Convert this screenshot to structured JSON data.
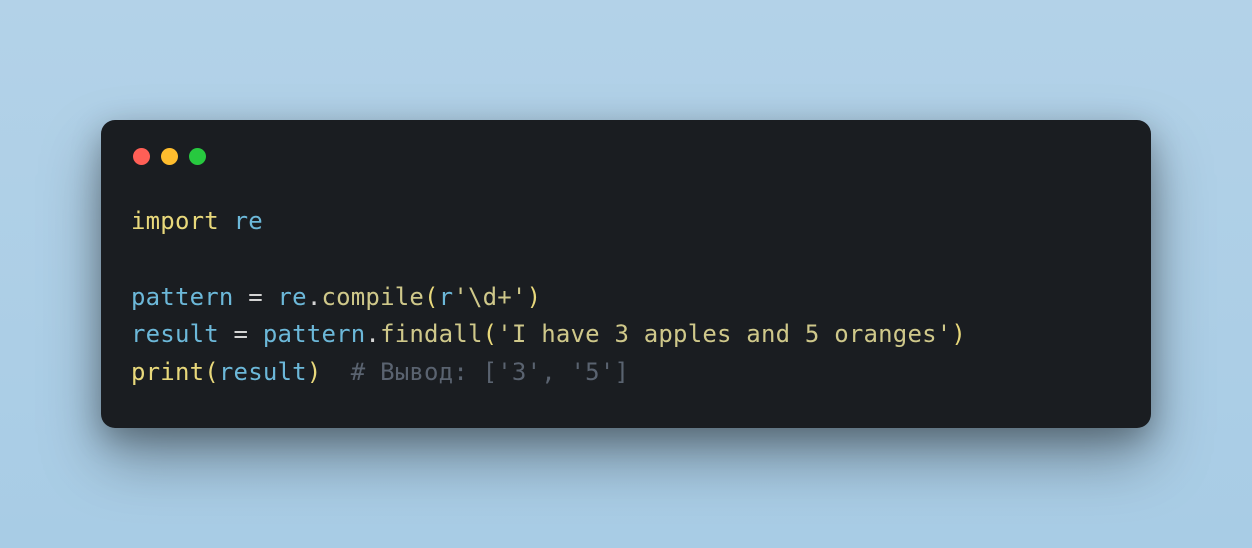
{
  "window": {
    "traffic_lights": [
      "red",
      "yellow",
      "green"
    ]
  },
  "code": {
    "line1": {
      "import_kw": "import",
      "module": "re"
    },
    "line2_blank": "",
    "line3": {
      "var": "pattern",
      "eq": " = ",
      "obj": "re",
      "dot": ".",
      "method": "compile",
      "open": "(",
      "prefix": "r",
      "str": "'\\d+'",
      "close": ")"
    },
    "line4": {
      "var": "result",
      "eq": " = ",
      "obj": "pattern",
      "dot": ".",
      "method": "findall",
      "open": "(",
      "str": "'I have 3 apples and 5 oranges'",
      "close": ")"
    },
    "line5": {
      "func": "print",
      "open": "(",
      "arg": "result",
      "close": ")",
      "spaces": "  ",
      "comment": "# Вывод: ['3', '5']"
    }
  }
}
